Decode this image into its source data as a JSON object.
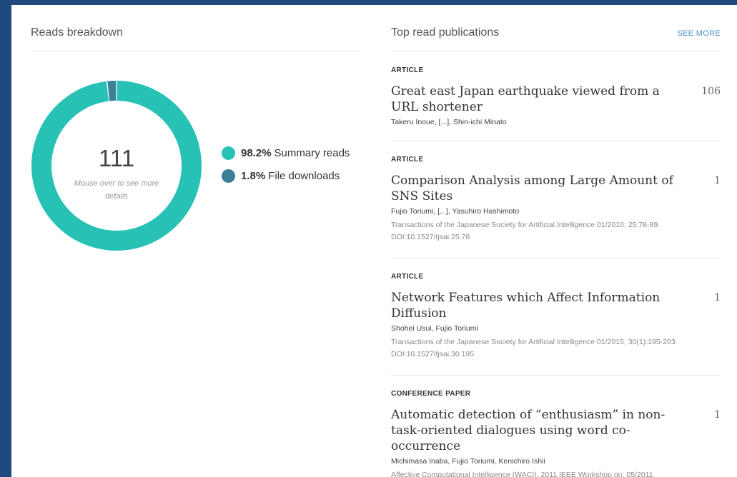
{
  "reads_breakdown": {
    "title": "Reads breakdown",
    "total": "111",
    "hint": "Mouse over to see more details",
    "legend": [
      {
        "pct": "98.2%",
        "label": "Summary reads",
        "color": "#27c2b5"
      },
      {
        "pct": "1.8%",
        "label": "File downloads",
        "color": "#3d7f99"
      }
    ]
  },
  "chart_data": {
    "type": "pie",
    "total": 111,
    "categories": [
      "Summary reads",
      "File downloads"
    ],
    "values": [
      98.2,
      1.8
    ],
    "colors": [
      "#27c2b5",
      "#3d7f99"
    ]
  },
  "top_read": {
    "title": "Top read publications",
    "see_more": "SEE MORE",
    "publications": [
      {
        "type": "ARTICLE",
        "title": "Great east Japan earthquake viewed from a URL shortener",
        "reads": "106",
        "authors": "Takeru Inoue, [...], Shin-ichi Minato",
        "source": ""
      },
      {
        "type": "ARTICLE",
        "title": "Comparison Analysis among Large Amount of SNS Sites",
        "reads": "1",
        "authors": "Fujio Toriumi, [...], Yasuhiro Hashimoto",
        "source": "Transactions of the Japanese Society for Artificial Intelligence 01/2010; 25:78-89. DOI:10.1527/tjsai.25.78"
      },
      {
        "type": "ARTICLE",
        "title": "Network Features which Affect Information Diffusion",
        "reads": "1",
        "authors": "Shohei Usui, Fujio Toriumi",
        "source": "Transactions of the Japanese Society for Artificial Intelligence 01/2015; 30(1):195-203. DOI:10.1527/tjsai.30.195"
      },
      {
        "type": "CONFERENCE PAPER",
        "title": "Automatic detection of “enthusiasm” in non-task-oriented dialogues using word co-occurrence",
        "reads": "1",
        "authors": "Michimasa Inaba, Fujio Toriumi, Kenichiro Ishii",
        "source": "Affective Computational Intelligence (WACI), 2011 IEEE Workshop on; 05/2011"
      }
    ]
  }
}
